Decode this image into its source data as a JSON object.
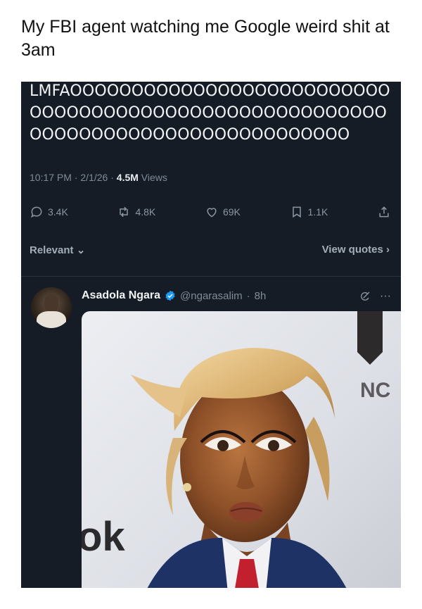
{
  "caption": "My FBI agent watching me Google weird shit at 3am",
  "tweet": {
    "text": "LMFAOOOOOOOOOOOOOOOOOOOOOOOOOOOOOOOOOOOOOOOOOOOOOOOOOOOOOOOOOOOOOOOOOOOOOOOOOOOOOOOOO",
    "time": "10:17 PM",
    "date": "2/1/26",
    "views_count": "4.5M",
    "views_label": "Views"
  },
  "actions": {
    "replies": "3.4K",
    "reposts": "4.8K",
    "likes": "69K",
    "bookmarks": "1.1K"
  },
  "filters": {
    "relevant": "Relevant",
    "view_quotes": "View quotes"
  },
  "reply": {
    "name": "Asadola Ngara",
    "handle": "@ngarasalim",
    "time": "8h"
  },
  "media": {
    "backdrop_letters": "NC",
    "backdrop_letters_2": "ok"
  },
  "colors": {
    "background": "#151c26",
    "verified": "#1d9bf0",
    "text_primary": "#f1f3f5",
    "text_secondary": "#7f8b97"
  },
  "icons": [
    "reply-icon",
    "repost-icon",
    "like-icon",
    "bookmark-icon",
    "share-icon",
    "verified-icon",
    "grok-icon",
    "more-icon"
  ]
}
